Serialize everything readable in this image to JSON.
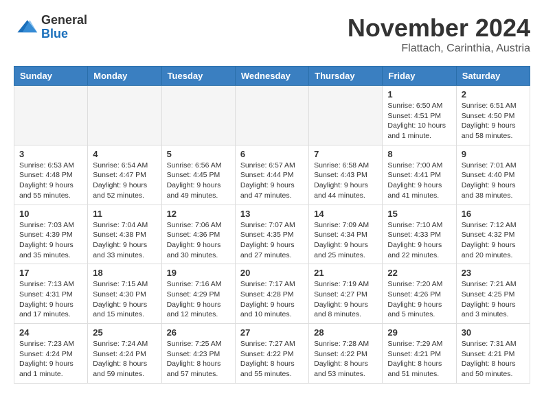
{
  "header": {
    "logo_general": "General",
    "logo_blue": "Blue",
    "month_title": "November 2024",
    "location": "Flattach, Carinthia, Austria"
  },
  "weekdays": [
    "Sunday",
    "Monday",
    "Tuesday",
    "Wednesday",
    "Thursday",
    "Friday",
    "Saturday"
  ],
  "weeks": [
    [
      {
        "day": "",
        "info": ""
      },
      {
        "day": "",
        "info": ""
      },
      {
        "day": "",
        "info": ""
      },
      {
        "day": "",
        "info": ""
      },
      {
        "day": "",
        "info": ""
      },
      {
        "day": "1",
        "info": "Sunrise: 6:50 AM\nSunset: 4:51 PM\nDaylight: 10 hours and 1 minute."
      },
      {
        "day": "2",
        "info": "Sunrise: 6:51 AM\nSunset: 4:50 PM\nDaylight: 9 hours and 58 minutes."
      }
    ],
    [
      {
        "day": "3",
        "info": "Sunrise: 6:53 AM\nSunset: 4:48 PM\nDaylight: 9 hours and 55 minutes."
      },
      {
        "day": "4",
        "info": "Sunrise: 6:54 AM\nSunset: 4:47 PM\nDaylight: 9 hours and 52 minutes."
      },
      {
        "day": "5",
        "info": "Sunrise: 6:56 AM\nSunset: 4:45 PM\nDaylight: 9 hours and 49 minutes."
      },
      {
        "day": "6",
        "info": "Sunrise: 6:57 AM\nSunset: 4:44 PM\nDaylight: 9 hours and 47 minutes."
      },
      {
        "day": "7",
        "info": "Sunrise: 6:58 AM\nSunset: 4:43 PM\nDaylight: 9 hours and 44 minutes."
      },
      {
        "day": "8",
        "info": "Sunrise: 7:00 AM\nSunset: 4:41 PM\nDaylight: 9 hours and 41 minutes."
      },
      {
        "day": "9",
        "info": "Sunrise: 7:01 AM\nSunset: 4:40 PM\nDaylight: 9 hours and 38 minutes."
      }
    ],
    [
      {
        "day": "10",
        "info": "Sunrise: 7:03 AM\nSunset: 4:39 PM\nDaylight: 9 hours and 35 minutes."
      },
      {
        "day": "11",
        "info": "Sunrise: 7:04 AM\nSunset: 4:38 PM\nDaylight: 9 hours and 33 minutes."
      },
      {
        "day": "12",
        "info": "Sunrise: 7:06 AM\nSunset: 4:36 PM\nDaylight: 9 hours and 30 minutes."
      },
      {
        "day": "13",
        "info": "Sunrise: 7:07 AM\nSunset: 4:35 PM\nDaylight: 9 hours and 27 minutes."
      },
      {
        "day": "14",
        "info": "Sunrise: 7:09 AM\nSunset: 4:34 PM\nDaylight: 9 hours and 25 minutes."
      },
      {
        "day": "15",
        "info": "Sunrise: 7:10 AM\nSunset: 4:33 PM\nDaylight: 9 hours and 22 minutes."
      },
      {
        "day": "16",
        "info": "Sunrise: 7:12 AM\nSunset: 4:32 PM\nDaylight: 9 hours and 20 minutes."
      }
    ],
    [
      {
        "day": "17",
        "info": "Sunrise: 7:13 AM\nSunset: 4:31 PM\nDaylight: 9 hours and 17 minutes."
      },
      {
        "day": "18",
        "info": "Sunrise: 7:15 AM\nSunset: 4:30 PM\nDaylight: 9 hours and 15 minutes."
      },
      {
        "day": "19",
        "info": "Sunrise: 7:16 AM\nSunset: 4:29 PM\nDaylight: 9 hours and 12 minutes."
      },
      {
        "day": "20",
        "info": "Sunrise: 7:17 AM\nSunset: 4:28 PM\nDaylight: 9 hours and 10 minutes."
      },
      {
        "day": "21",
        "info": "Sunrise: 7:19 AM\nSunset: 4:27 PM\nDaylight: 9 hours and 8 minutes."
      },
      {
        "day": "22",
        "info": "Sunrise: 7:20 AM\nSunset: 4:26 PM\nDaylight: 9 hours and 5 minutes."
      },
      {
        "day": "23",
        "info": "Sunrise: 7:21 AM\nSunset: 4:25 PM\nDaylight: 9 hours and 3 minutes."
      }
    ],
    [
      {
        "day": "24",
        "info": "Sunrise: 7:23 AM\nSunset: 4:24 PM\nDaylight: 9 hours and 1 minute."
      },
      {
        "day": "25",
        "info": "Sunrise: 7:24 AM\nSunset: 4:24 PM\nDaylight: 8 hours and 59 minutes."
      },
      {
        "day": "26",
        "info": "Sunrise: 7:25 AM\nSunset: 4:23 PM\nDaylight: 8 hours and 57 minutes."
      },
      {
        "day": "27",
        "info": "Sunrise: 7:27 AM\nSunset: 4:22 PM\nDaylight: 8 hours and 55 minutes."
      },
      {
        "day": "28",
        "info": "Sunrise: 7:28 AM\nSunset: 4:22 PM\nDaylight: 8 hours and 53 minutes."
      },
      {
        "day": "29",
        "info": "Sunrise: 7:29 AM\nSunset: 4:21 PM\nDaylight: 8 hours and 51 minutes."
      },
      {
        "day": "30",
        "info": "Sunrise: 7:31 AM\nSunset: 4:21 PM\nDaylight: 8 hours and 50 minutes."
      }
    ]
  ]
}
